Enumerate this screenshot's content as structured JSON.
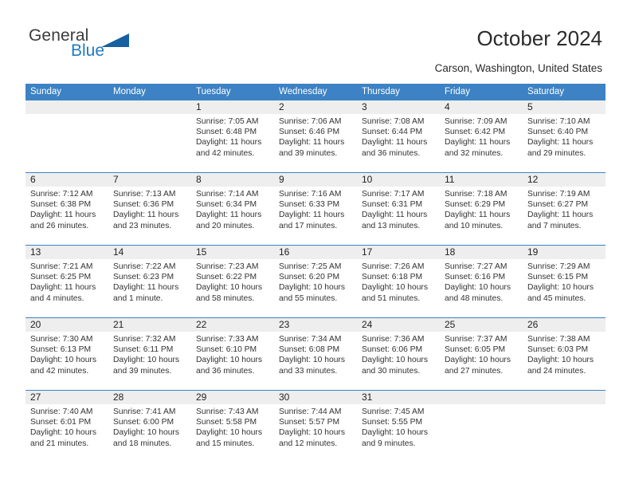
{
  "brand": {
    "name_top": "General",
    "name_bottom": "Blue",
    "accent_color": "#16609f",
    "blue_text_color": "#1f7bc1"
  },
  "header": {
    "title": "October 2024",
    "subtitle": "Carson, Washington, United States"
  },
  "theme": {
    "header_bar_color": "#3c82c4",
    "daynum_band_color": "#eeeeee",
    "row_rule_color": "#3c82c4"
  },
  "day_names": [
    "Sunday",
    "Monday",
    "Tuesday",
    "Wednesday",
    "Thursday",
    "Friday",
    "Saturday"
  ],
  "labels": {
    "sunrise_prefix": "Sunrise:",
    "sunset_prefix": "Sunset:",
    "daylight_prefix": "Daylight:"
  },
  "weeks": [
    [
      {
        "day": "",
        "sunrise": "",
        "sunset": "",
        "daylight": "",
        "empty": true
      },
      {
        "day": "",
        "sunrise": "",
        "sunset": "",
        "daylight": "",
        "empty": true
      },
      {
        "day": "1",
        "sunrise": "Sunrise: 7:05 AM",
        "sunset": "Sunset: 6:48 PM",
        "daylight": "Daylight: 11 hours and 42 minutes."
      },
      {
        "day": "2",
        "sunrise": "Sunrise: 7:06 AM",
        "sunset": "Sunset: 6:46 PM",
        "daylight": "Daylight: 11 hours and 39 minutes."
      },
      {
        "day": "3",
        "sunrise": "Sunrise: 7:08 AM",
        "sunset": "Sunset: 6:44 PM",
        "daylight": "Daylight: 11 hours and 36 minutes."
      },
      {
        "day": "4",
        "sunrise": "Sunrise: 7:09 AM",
        "sunset": "Sunset: 6:42 PM",
        "daylight": "Daylight: 11 hours and 32 minutes."
      },
      {
        "day": "5",
        "sunrise": "Sunrise: 7:10 AM",
        "sunset": "Sunset: 6:40 PM",
        "daylight": "Daylight: 11 hours and 29 minutes."
      }
    ],
    [
      {
        "day": "6",
        "sunrise": "Sunrise: 7:12 AM",
        "sunset": "Sunset: 6:38 PM",
        "daylight": "Daylight: 11 hours and 26 minutes."
      },
      {
        "day": "7",
        "sunrise": "Sunrise: 7:13 AM",
        "sunset": "Sunset: 6:36 PM",
        "daylight": "Daylight: 11 hours and 23 minutes."
      },
      {
        "day": "8",
        "sunrise": "Sunrise: 7:14 AM",
        "sunset": "Sunset: 6:34 PM",
        "daylight": "Daylight: 11 hours and 20 minutes."
      },
      {
        "day": "9",
        "sunrise": "Sunrise: 7:16 AM",
        "sunset": "Sunset: 6:33 PM",
        "daylight": "Daylight: 11 hours and 17 minutes."
      },
      {
        "day": "10",
        "sunrise": "Sunrise: 7:17 AM",
        "sunset": "Sunset: 6:31 PM",
        "daylight": "Daylight: 11 hours and 13 minutes."
      },
      {
        "day": "11",
        "sunrise": "Sunrise: 7:18 AM",
        "sunset": "Sunset: 6:29 PM",
        "daylight": "Daylight: 11 hours and 10 minutes."
      },
      {
        "day": "12",
        "sunrise": "Sunrise: 7:19 AM",
        "sunset": "Sunset: 6:27 PM",
        "daylight": "Daylight: 11 hours and 7 minutes."
      }
    ],
    [
      {
        "day": "13",
        "sunrise": "Sunrise: 7:21 AM",
        "sunset": "Sunset: 6:25 PM",
        "daylight": "Daylight: 11 hours and 4 minutes."
      },
      {
        "day": "14",
        "sunrise": "Sunrise: 7:22 AM",
        "sunset": "Sunset: 6:23 PM",
        "daylight": "Daylight: 11 hours and 1 minute."
      },
      {
        "day": "15",
        "sunrise": "Sunrise: 7:23 AM",
        "sunset": "Sunset: 6:22 PM",
        "daylight": "Daylight: 10 hours and 58 minutes."
      },
      {
        "day": "16",
        "sunrise": "Sunrise: 7:25 AM",
        "sunset": "Sunset: 6:20 PM",
        "daylight": "Daylight: 10 hours and 55 minutes."
      },
      {
        "day": "17",
        "sunrise": "Sunrise: 7:26 AM",
        "sunset": "Sunset: 6:18 PM",
        "daylight": "Daylight: 10 hours and 51 minutes."
      },
      {
        "day": "18",
        "sunrise": "Sunrise: 7:27 AM",
        "sunset": "Sunset: 6:16 PM",
        "daylight": "Daylight: 10 hours and 48 minutes."
      },
      {
        "day": "19",
        "sunrise": "Sunrise: 7:29 AM",
        "sunset": "Sunset: 6:15 PM",
        "daylight": "Daylight: 10 hours and 45 minutes."
      }
    ],
    [
      {
        "day": "20",
        "sunrise": "Sunrise: 7:30 AM",
        "sunset": "Sunset: 6:13 PM",
        "daylight": "Daylight: 10 hours and 42 minutes."
      },
      {
        "day": "21",
        "sunrise": "Sunrise: 7:32 AM",
        "sunset": "Sunset: 6:11 PM",
        "daylight": "Daylight: 10 hours and 39 minutes."
      },
      {
        "day": "22",
        "sunrise": "Sunrise: 7:33 AM",
        "sunset": "Sunset: 6:10 PM",
        "daylight": "Daylight: 10 hours and 36 minutes."
      },
      {
        "day": "23",
        "sunrise": "Sunrise: 7:34 AM",
        "sunset": "Sunset: 6:08 PM",
        "daylight": "Daylight: 10 hours and 33 minutes."
      },
      {
        "day": "24",
        "sunrise": "Sunrise: 7:36 AM",
        "sunset": "Sunset: 6:06 PM",
        "daylight": "Daylight: 10 hours and 30 minutes."
      },
      {
        "day": "25",
        "sunrise": "Sunrise: 7:37 AM",
        "sunset": "Sunset: 6:05 PM",
        "daylight": "Daylight: 10 hours and 27 minutes."
      },
      {
        "day": "26",
        "sunrise": "Sunrise: 7:38 AM",
        "sunset": "Sunset: 6:03 PM",
        "daylight": "Daylight: 10 hours and 24 minutes."
      }
    ],
    [
      {
        "day": "27",
        "sunrise": "Sunrise: 7:40 AM",
        "sunset": "Sunset: 6:01 PM",
        "daylight": "Daylight: 10 hours and 21 minutes."
      },
      {
        "day": "28",
        "sunrise": "Sunrise: 7:41 AM",
        "sunset": "Sunset: 6:00 PM",
        "daylight": "Daylight: 10 hours and 18 minutes."
      },
      {
        "day": "29",
        "sunrise": "Sunrise: 7:43 AM",
        "sunset": "Sunset: 5:58 PM",
        "daylight": "Daylight: 10 hours and 15 minutes."
      },
      {
        "day": "30",
        "sunrise": "Sunrise: 7:44 AM",
        "sunset": "Sunset: 5:57 PM",
        "daylight": "Daylight: 10 hours and 12 minutes."
      },
      {
        "day": "31",
        "sunrise": "Sunrise: 7:45 AM",
        "sunset": "Sunset: 5:55 PM",
        "daylight": "Daylight: 10 hours and 9 minutes."
      },
      {
        "day": "",
        "sunrise": "",
        "sunset": "",
        "daylight": "",
        "empty": true
      },
      {
        "day": "",
        "sunrise": "",
        "sunset": "",
        "daylight": "",
        "empty": true
      }
    ]
  ]
}
